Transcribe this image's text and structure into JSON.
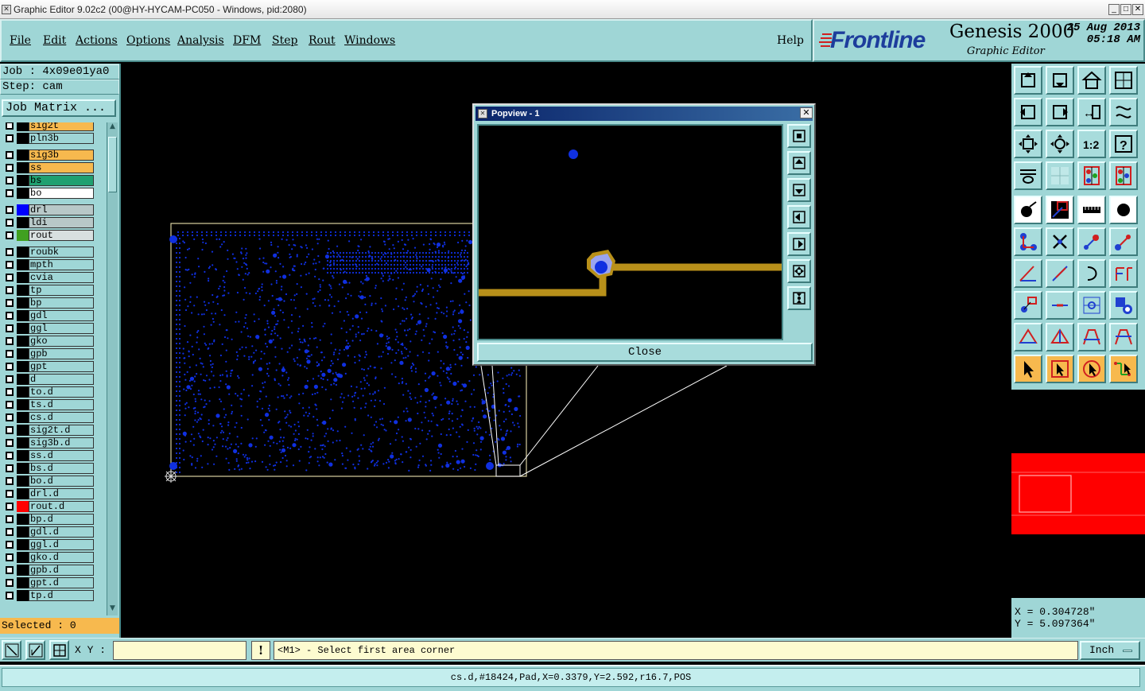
{
  "window": {
    "title": "Graphic Editor 9.02c2 (00@HY-HYCAM-PC050 - Windows, pid:2080)"
  },
  "menu": [
    "File",
    "Edit",
    "Actions",
    "Options",
    "Analysis",
    "DFM",
    "Step",
    "Rout",
    "Windows"
  ],
  "help_label": "Help",
  "brand": {
    "logo": "Frontline",
    "product": "Genesis 2000",
    "subtitle": "Graphic Editor",
    "date": "25 Aug 2013",
    "time": "05:18 AM"
  },
  "job": {
    "job_line": "Job : 4x09e01ya0",
    "step_line": "Step: cam",
    "matrix_button": "Job Matrix ..."
  },
  "layers": [
    {
      "name": "sig2t",
      "bg": "#f7b94e",
      "swatch": "#000000"
    },
    {
      "name": "pln3b",
      "bg": "#9fd6d6",
      "swatch": "#000000"
    },
    {
      "name": "sig3b",
      "bg": "#f7b94e",
      "swatch": "#000000"
    },
    {
      "name": "ss",
      "bg": "#f7b94e",
      "swatch": "#000000"
    },
    {
      "name": "bs",
      "bg": "#20a070",
      "swatch": "#000000"
    },
    {
      "name": "bo",
      "bg": "#ffffff",
      "swatch": "#000000"
    },
    {
      "name": "drl",
      "bg": "#b8c8c8",
      "swatch": "#0000ff"
    },
    {
      "name": "ldi",
      "bg": "#b8c8c8",
      "swatch": "#000000"
    },
    {
      "name": "rout",
      "bg": "#d8e0e0",
      "swatch": "#40a020"
    },
    {
      "name": "roubk",
      "bg": "#9fd6d6",
      "swatch": "#000000"
    },
    {
      "name": "mpth",
      "bg": "#9fd6d6",
      "swatch": "#000000"
    },
    {
      "name": "cvia",
      "bg": "#9fd6d6",
      "swatch": "#000000"
    },
    {
      "name": "tp",
      "bg": "#9fd6d6",
      "swatch": "#000000"
    },
    {
      "name": "bp",
      "bg": "#9fd6d6",
      "swatch": "#000000"
    },
    {
      "name": "gdl",
      "bg": "#9fd6d6",
      "swatch": "#000000"
    },
    {
      "name": "ggl",
      "bg": "#9fd6d6",
      "swatch": "#000000"
    },
    {
      "name": "gko",
      "bg": "#9fd6d6",
      "swatch": "#000000"
    },
    {
      "name": "gpb",
      "bg": "#9fd6d6",
      "swatch": "#000000"
    },
    {
      "name": "gpt",
      "bg": "#9fd6d6",
      "swatch": "#000000"
    },
    {
      "name": "d",
      "bg": "#9fd6d6",
      "swatch": "#000000"
    },
    {
      "name": "to.d",
      "bg": "#9fd6d6",
      "swatch": "#000000"
    },
    {
      "name": "ts.d",
      "bg": "#9fd6d6",
      "swatch": "#000000"
    },
    {
      "name": "cs.d",
      "bg": "#9fd6d6",
      "swatch": "#000000"
    },
    {
      "name": "sig2t.d",
      "bg": "#9fd6d6",
      "swatch": "#000000"
    },
    {
      "name": "sig3b.d",
      "bg": "#9fd6d6",
      "swatch": "#000000"
    },
    {
      "name": "ss.d",
      "bg": "#9fd6d6",
      "swatch": "#000000"
    },
    {
      "name": "bs.d",
      "bg": "#9fd6d6",
      "swatch": "#000000"
    },
    {
      "name": "bo.d",
      "bg": "#9fd6d6",
      "swatch": "#000000"
    },
    {
      "name": "drl.d",
      "bg": "#9fd6d6",
      "swatch": "#000000"
    },
    {
      "name": "rout.d",
      "bg": "#9fd6d6",
      "swatch": "#ff0000"
    },
    {
      "name": "bp.d",
      "bg": "#9fd6d6",
      "swatch": "#000000"
    },
    {
      "name": "gdl.d",
      "bg": "#9fd6d6",
      "swatch": "#000000"
    },
    {
      "name": "ggl.d",
      "bg": "#9fd6d6",
      "swatch": "#000000"
    },
    {
      "name": "gko.d",
      "bg": "#9fd6d6",
      "swatch": "#000000"
    },
    {
      "name": "gpb.d",
      "bg": "#9fd6d6",
      "swatch": "#000000"
    },
    {
      "name": "gpt.d",
      "bg": "#9fd6d6",
      "swatch": "#000000"
    },
    {
      "name": "tp.d",
      "bg": "#9fd6d6",
      "swatch": "#000000"
    }
  ],
  "selected": "Selected : 0",
  "popview": {
    "title": "Popview - 1",
    "close_label": "Close"
  },
  "coords": {
    "x": "X = 0.304728\"",
    "y": "Y = 5.097364\""
  },
  "command": {
    "xy_label": "X Y :",
    "xy_value": "",
    "bang": "!",
    "prompt": "<M1> - Select first area corner",
    "unit": "Inch"
  },
  "status": "cs.d,#18424,Pad,X=0.3379,Y=2.592,r16.7,POS",
  "colors": {
    "panel": "#9fd6d6",
    "accent": "#f7b94e",
    "pad": "#1030e0",
    "trace": "#b8901a"
  }
}
